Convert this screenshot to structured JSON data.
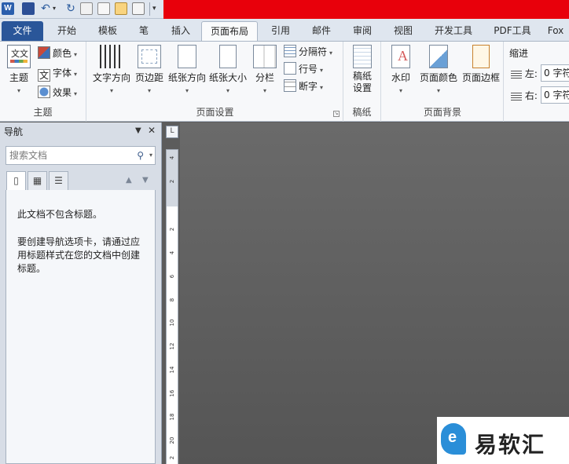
{
  "app": {
    "logo_letter": "W",
    "accent": "#2a5699",
    "title_bar_color": "#e8000b"
  },
  "tabs": [
    {
      "label": "文件"
    },
    {
      "label": "开始"
    },
    {
      "label": "模板"
    },
    {
      "label": "笔"
    },
    {
      "label": "插入"
    },
    {
      "label": "页面布局"
    },
    {
      "label": "引用"
    },
    {
      "label": "邮件"
    },
    {
      "label": "审阅"
    },
    {
      "label": "视图"
    },
    {
      "label": "开发工具"
    },
    {
      "label": "PDF工具"
    },
    {
      "label": "Fox"
    }
  ],
  "active_tab": "页面布局",
  "ribbon": {
    "theme": {
      "label": "主题",
      "group": "主题",
      "icon_text": "文文",
      "colors": "颜色",
      "fonts": "字体",
      "fonts_icon_text": "文",
      "effects": "效果"
    },
    "page_setup": {
      "group": "页面设置",
      "text_direction": "文字方向",
      "margins": "页边距",
      "orientation": "纸张方向",
      "size": "纸张大小",
      "columns": "分栏",
      "breaks": "分隔符",
      "line_numbers": "行号",
      "hyphenation": "断字"
    },
    "draft": {
      "group": "稿纸",
      "label": "稿纸\n设置"
    },
    "page_bg": {
      "group": "页面背景",
      "watermark": "水印",
      "page_color": "页面颜色",
      "page_border": "页面边框"
    },
    "indent": {
      "title": "缩进",
      "left_label": "左:",
      "left_value": "0 字符",
      "right_label": "右:",
      "right_value": "0 字符"
    }
  },
  "nav": {
    "title": "导航",
    "search_placeholder": "搜索文档",
    "message_line1": "此文档不包含标题。",
    "message_line2": "要创建导航选项卡，请通过应用标题样式在您的文档中创建标题。"
  },
  "ruler": {
    "corner": "L",
    "ticks": [
      "4",
      "2",
      "",
      "2",
      "4",
      "6",
      "8",
      "10",
      "12",
      "14",
      "16",
      "18",
      "20",
      "2"
    ]
  },
  "watermark": {
    "text": "易软汇"
  }
}
